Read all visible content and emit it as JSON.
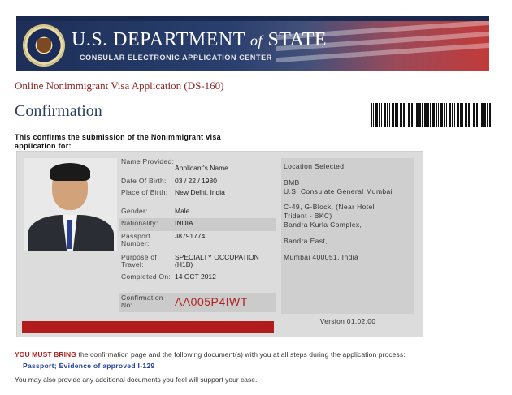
{
  "banner": {
    "title_main": "U.S. DEPARTMENT",
    "title_of": "of",
    "title_end": "STATE",
    "subtitle": "CONSULAR ELECTRONIC APPLICATION CENTER"
  },
  "app_title": "Online Nonimmigrant Visa Application (DS-160)",
  "page_title": "Confirmation",
  "intro": "This confirms the submission of the Nonimmigrant visa application for:",
  "fields": [
    {
      "label": "Name Provided:",
      "value": "Applicant's Name"
    },
    {
      "label": "Date Of Birth:",
      "value": "03 / 22 / 1980"
    },
    {
      "label": "Place of Birth:",
      "value": "New Delhi, India"
    },
    {
      "label": "Gender:",
      "value": "Male"
    },
    {
      "label": "Nationality:",
      "value": "INDIA"
    },
    {
      "label": "Passport Number:",
      "value": "J8791774"
    },
    {
      "label": "Purpose of Travel:",
      "value": "SPECIALTY OCCUPATION (H1B)"
    },
    {
      "label": "Completed On:",
      "value": "14 OCT 2012"
    },
    {
      "label": "Confirmation No:",
      "value": "AA005P4IWT"
    }
  ],
  "location": {
    "heading": "Location Selected:",
    "code": "BMB",
    "name": "U.S. Consulate General Mumbai",
    "addr1": "C-49, G-Block, (Near Hotel",
    "addr2": "Trident - BKC)",
    "addr3": "Bandra Kurla Complex,",
    "addr4": "Bandra East,",
    "addr5": "Mumbai 400051, India"
  },
  "version": "Version 01.02.00",
  "must_bring_label": "YOU MUST BRING",
  "must_bring_text": " the confirmation page and the following document(s) with you at all steps during the application process:",
  "documents": "Passport; Evidence of approved I-129",
  "additional": "You may also provide any additional documents you feel will support your case."
}
